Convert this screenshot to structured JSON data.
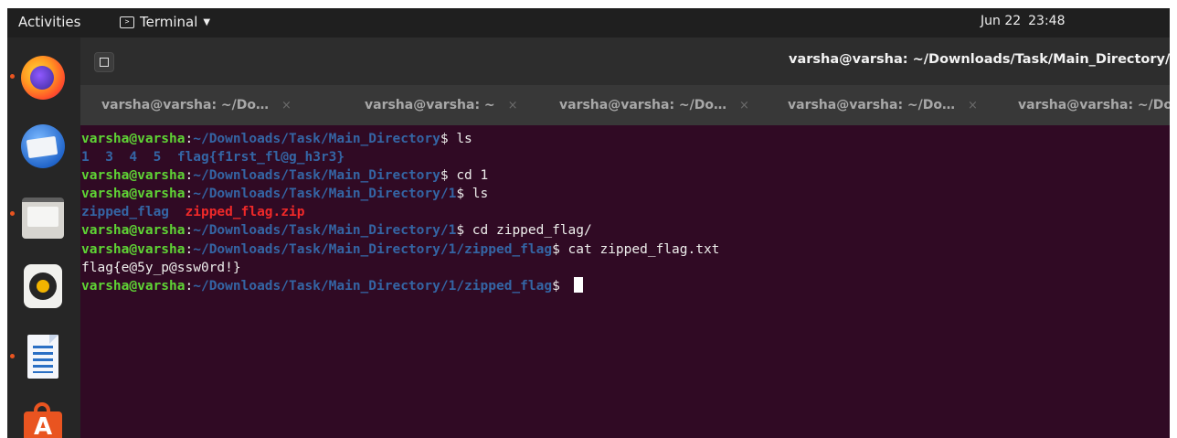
{
  "topbar": {
    "activities": "Activities",
    "app_name": "Terminal",
    "clock_date": "Jun 22",
    "clock_time": "23:48"
  },
  "dock": {
    "items": [
      {
        "name": "firefox",
        "running": true
      },
      {
        "name": "thunderbird",
        "running": false
      },
      {
        "name": "files",
        "running": true
      },
      {
        "name": "rhythmbox",
        "running": false
      },
      {
        "name": "libreoffice-writer",
        "running": true
      },
      {
        "name": "ubuntu-software",
        "running": false
      }
    ]
  },
  "window": {
    "title": "varsha@varsha: ~/Downloads/Task/Main_Directory/1/",
    "tabs": [
      {
        "label": "varsha@varsha: ~/Do…",
        "close": "×"
      },
      {
        "label": "varsha@varsha: ~",
        "close": "×"
      },
      {
        "label": "varsha@varsha: ~/Do…",
        "close": "×"
      },
      {
        "label": "varsha@varsha: ~/Do…",
        "close": "×"
      },
      {
        "label": "varsha@varsha: ~/Do",
        "close": ""
      }
    ]
  },
  "terminal": {
    "user_host": "varsha@varsha",
    "sep": ":",
    "lines": [
      {
        "path": "~/Downloads/Task/Main_Directory",
        "prompt": "$ ",
        "cmd": "ls"
      },
      {
        "ls": [
          "1",
          "3",
          "4",
          "5",
          "flag{f1rst_fl@g_h3r3}"
        ]
      },
      {
        "path": "~/Downloads/Task/Main_Directory",
        "prompt": "$ ",
        "cmd": "cd 1"
      },
      {
        "path": "~/Downloads/Task/Main_Directory/1",
        "prompt": "$ ",
        "cmd": "ls"
      },
      {
        "dir": "zipped_flag",
        "zip": "zipped_flag.zip"
      },
      {
        "path": "~/Downloads/Task/Main_Directory/1",
        "prompt": "$ ",
        "cmd": "cd zipped_flag/"
      },
      {
        "path": "~/Downloads/Task/Main_Directory/1/zipped_flag",
        "prompt": "$ ",
        "cmd": "cat zipped_flag.txt"
      },
      {
        "out": "flag{e@5y_p@ssw0rd!}"
      },
      {
        "path": "~/Downloads/Task/Main_Directory/1/zipped_flag",
        "prompt": "$ ",
        "cmd": ""
      }
    ]
  },
  "colors": {
    "terminal_bg": "#300a24",
    "prompt_user": "#5fd435",
    "prompt_path": "#3465a4",
    "archive": "#ef2929",
    "accent": "#e95420"
  }
}
